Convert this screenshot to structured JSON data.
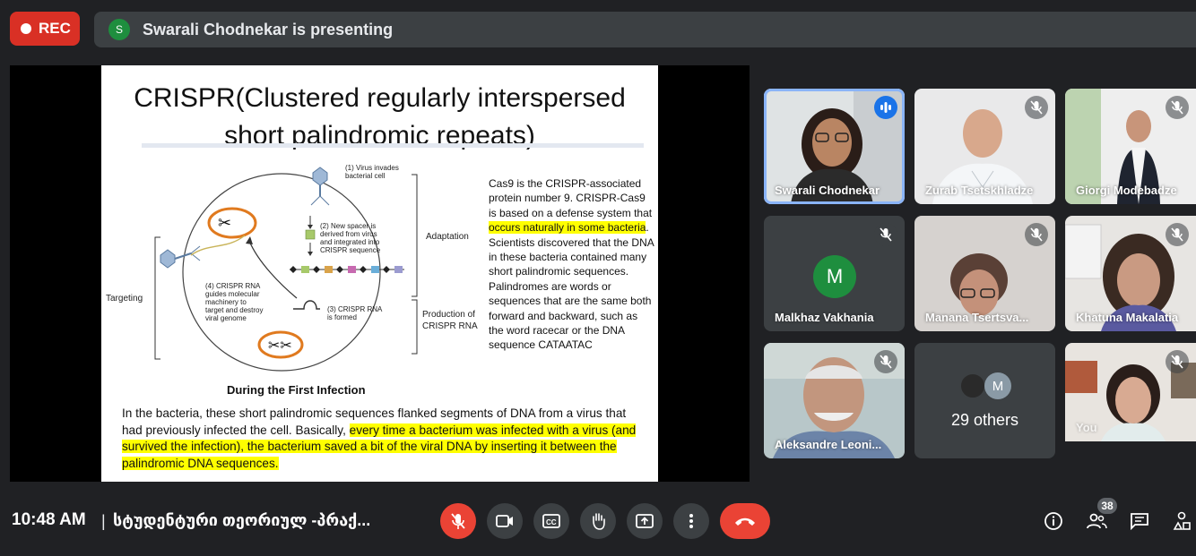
{
  "top": {
    "rec_label": "REC",
    "presenter_initial": "S",
    "presenting_text": "Swarali Chodnekar is presenting"
  },
  "slide": {
    "title_line1": "CRISPR(Clustered regularly interspersed",
    "title_line2": "short palindromic repeats)",
    "diagram_labels": {
      "virus_invades": [
        "(1) Virus invades",
        "bacterial cell"
      ],
      "new_spacer": [
        "(2) New spacer is",
        "derived from virus",
        "and integrated into",
        "CRISPR sequence"
      ],
      "crispr_rna": [
        "(3) CRISPR RNA",
        "is formed"
      ],
      "guides": [
        "(4) CRISPR RNA",
        "guides molecular",
        "machinery to",
        "target and destroy",
        "viral genome"
      ],
      "adaptation": "Adaptation",
      "targeting": "Targeting",
      "production": [
        "Production of",
        "CRISPR RNA"
      ]
    },
    "diagram_caption": "During the First Infection",
    "side_p1_a": "Cas9 is the CRISPR-associated protein number 9. CRISPR-Cas9 is based on a defense system that ",
    "side_p1_hl": "occurs naturally in some bacteria",
    "side_p1_b": ".",
    "side_p2": "Scientists discovered that the DNA in these bacteria contained many short palindromic sequences. Palindromes are words or sequences that are the same both forward and backward, such as the word racecar or the DNA sequence CATAATAC",
    "bottom_a": "In the bacteria, these short palindromic sequences flanked segments of DNA from a virus that had previously infected the cell. Basically, ",
    "bottom_hl": "every time a bacterium was infected with a virus (and survived the infection), the bacterium saved a bit of the viral DNA by inserting it between the palindromic DNA sequences."
  },
  "participants": [
    {
      "name": "Swarali Chodnekar"
    },
    {
      "name": "Zurab Tsetskhladze"
    },
    {
      "name": "Giorgi Modebadze"
    },
    {
      "name": "Malkhaz Vakhania",
      "initial": "M"
    },
    {
      "name": "Manana Tsertsva..."
    },
    {
      "name": "Khatuna Makalatia"
    },
    {
      "name": "Aleksandre Leoni..."
    },
    {
      "name": "29 others",
      "initial": "M"
    },
    {
      "name": "You"
    }
  ],
  "bottom": {
    "time": "10:48 AM",
    "separator": "|",
    "meeting_name": "სტუდენტური თეორიულ -პრაქ...",
    "people_count": "38"
  },
  "colors": {
    "rec": "#d93025",
    "hangup": "#ea4335",
    "active_outline": "#8ab4f8",
    "highlight": "#ffff00",
    "avatar_green": "#1e8e3e"
  },
  "icons": [
    "mic-off-icon",
    "camera-icon",
    "captions-icon",
    "raise-hand-icon",
    "present-icon",
    "more-icon",
    "hangup-icon",
    "info-icon",
    "people-icon",
    "chat-icon",
    "activities-icon"
  ]
}
